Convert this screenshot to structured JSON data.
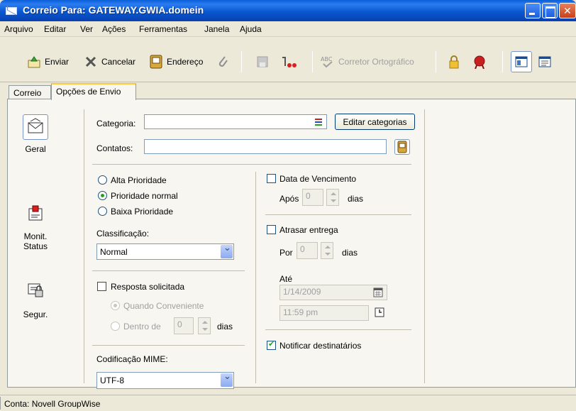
{
  "window": {
    "title": "Correio Para: GATEWAY.GWIA.domein"
  },
  "menu": [
    "Arquivo",
    "Editar",
    "Ver",
    "Ações",
    "Ferramentas",
    "Janela",
    "Ajuda"
  ],
  "toolbar": {
    "send": "Enviar",
    "cancel": "Cancelar",
    "address": "Endereço",
    "spell": "Corretor Ortográfico"
  },
  "tabs": {
    "mail": "Correio",
    "send_options": "Opções de Envio"
  },
  "sidebar": [
    {
      "label": "Geral"
    },
    {
      "label": "Monit. Status"
    },
    {
      "label": "Segur."
    }
  ],
  "form": {
    "category_label": "Categoria:",
    "category_value": "",
    "edit_categories": "Editar categorias",
    "contacts_label": "Contatos:",
    "contacts_value": "",
    "priority_high": "Alta Prioridade",
    "priority_normal": "Prioridade normal",
    "priority_low": "Baixa Prioridade",
    "classification_label": "Classificação:",
    "classification_value": "Normal",
    "reply_requested": "Resposta solicitada",
    "when_convenient": "Quando Conveniente",
    "within": "Dentro de",
    "within_value": "0",
    "days": "dias",
    "mime_label": "Codificação MIME:",
    "mime_value": "UTF-8",
    "due_date": "Data de Vencimento",
    "after": "Após",
    "after_value": "0",
    "delay_delivery": "Atrasar entrega",
    "by": "Por",
    "by_value": "0",
    "until": "Até",
    "date_value": "1/14/2009",
    "time_value": "11:59 pm",
    "notify": "Notificar destinatários"
  },
  "status": {
    "account": "Conta: Novell GroupWise"
  }
}
